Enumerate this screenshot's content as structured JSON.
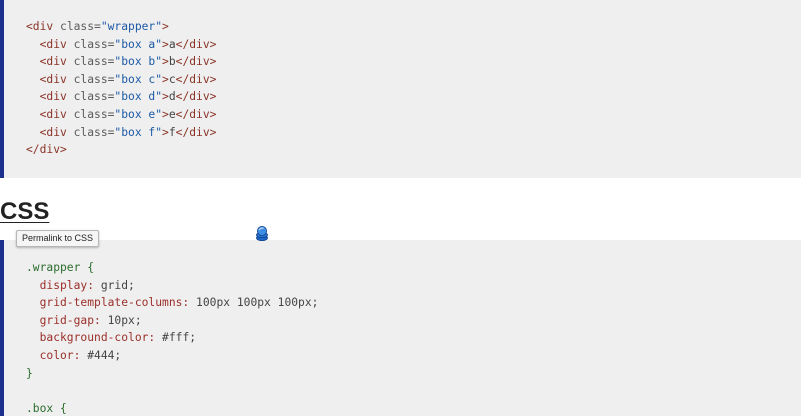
{
  "html_code": {
    "lines": [
      {
        "open": "<div ",
        "attr": "class=",
        "value": "\"wrapper\"",
        "close": ">",
        "text": "",
        "end": ""
      },
      {
        "open": "  <div ",
        "attr": "class=",
        "value": "\"box a\"",
        "close": ">",
        "text": "a",
        "end": "</div>"
      },
      {
        "open": "  <div ",
        "attr": "class=",
        "value": "\"box b\"",
        "close": ">",
        "text": "b",
        "end": "</div>"
      },
      {
        "open": "  <div ",
        "attr": "class=",
        "value": "\"box c\"",
        "close": ">",
        "text": "c",
        "end": "</div>"
      },
      {
        "open": "  <div ",
        "attr": "class=",
        "value": "\"box d\"",
        "close": ">",
        "text": "d",
        "end": "</div>"
      },
      {
        "open": "  <div ",
        "attr": "class=",
        "value": "\"box e\"",
        "close": ">",
        "text": "e",
        "end": "</div>"
      },
      {
        "open": "  <div ",
        "attr": "class=",
        "value": "\"box f\"",
        "close": ">",
        "text": "f",
        "end": "</div>"
      },
      {
        "open": "</div>",
        "attr": "",
        "value": "",
        "close": "",
        "text": "",
        "end": ""
      }
    ]
  },
  "section": {
    "heading": "CSS",
    "permalink_tooltip": "Permalink to CSS"
  },
  "css_code": {
    "lines": [
      {
        "selector": ".wrapper {",
        "prop": "",
        "value": ""
      },
      {
        "selector": "",
        "prop": "  display:",
        "value": " grid;"
      },
      {
        "selector": "",
        "prop": "  grid-template-columns:",
        "value": " 100px 100px 100px;"
      },
      {
        "selector": "",
        "prop": "  grid-gap:",
        "value": " 10px;"
      },
      {
        "selector": "",
        "prop": "  background-color:",
        "value": " #fff;"
      },
      {
        "selector": "",
        "prop": "  color:",
        "value": " #444;"
      },
      {
        "selector": "}",
        "prop": "",
        "value": ""
      },
      {
        "selector": "",
        "prop": "",
        "value": ""
      },
      {
        "selector": ".box {",
        "prop": "",
        "value": ""
      }
    ]
  },
  "colors": {
    "code_background": "#efefef",
    "code_accent_border": "#1b2f8f",
    "tag": "#8a3327",
    "string": "#1d5aa6",
    "selector": "#2c6d2e",
    "property": "#9b2f2a"
  },
  "icons": {
    "cursor": "busy-cursor-icon"
  }
}
